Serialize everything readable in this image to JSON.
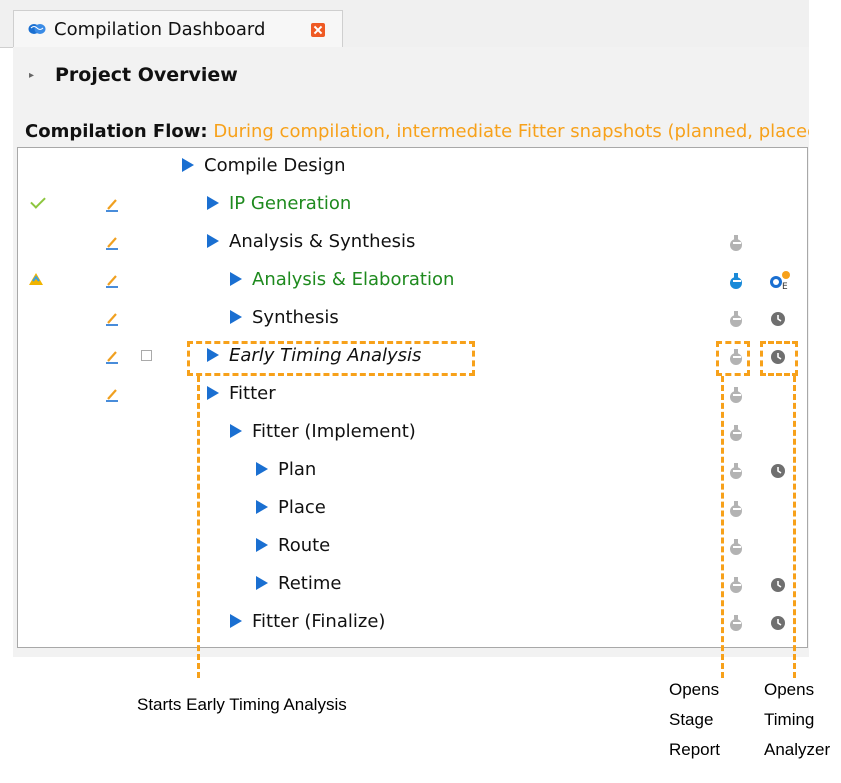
{
  "tab": {
    "label": "Compilation Dashboard",
    "icon": "brain-icon"
  },
  "overview": {
    "label": "Project Overview"
  },
  "flow": {
    "title": "Compilation Flow:",
    "description": " During compilation, intermediate Fitter snapshots (planned, placed, routed, retimed) ..."
  },
  "tree": {
    "rows": [
      {
        "label": "Compile Design"
      },
      {
        "label": "IP Generation"
      },
      {
        "label": "Analysis & Synthesis"
      },
      {
        "label": "Analysis & Elaboration"
      },
      {
        "label": "Synthesis"
      },
      {
        "label": "Early Timing Analysis"
      },
      {
        "label": "Fitter"
      },
      {
        "label": "Fitter (Implement)"
      },
      {
        "label": "Plan"
      },
      {
        "label": "Place"
      },
      {
        "label": "Route"
      },
      {
        "label": "Retime"
      },
      {
        "label": "Fitter (Finalize)"
      }
    ]
  },
  "callouts": {
    "early": "Starts Early Timing Analysis",
    "stage_1": "Opens",
    "stage_2": "Stage",
    "stage_3": "Report",
    "timing_1": "Opens",
    "timing_2": "Timing",
    "timing_3": "Analyzer"
  },
  "colors": {
    "accent_orange": "#f7a11a",
    "arrow_blue": "#1a6fd1",
    "status_green": "#1e8a1e",
    "check_green": "#8dc63f",
    "close_red": "#ef5a24"
  }
}
